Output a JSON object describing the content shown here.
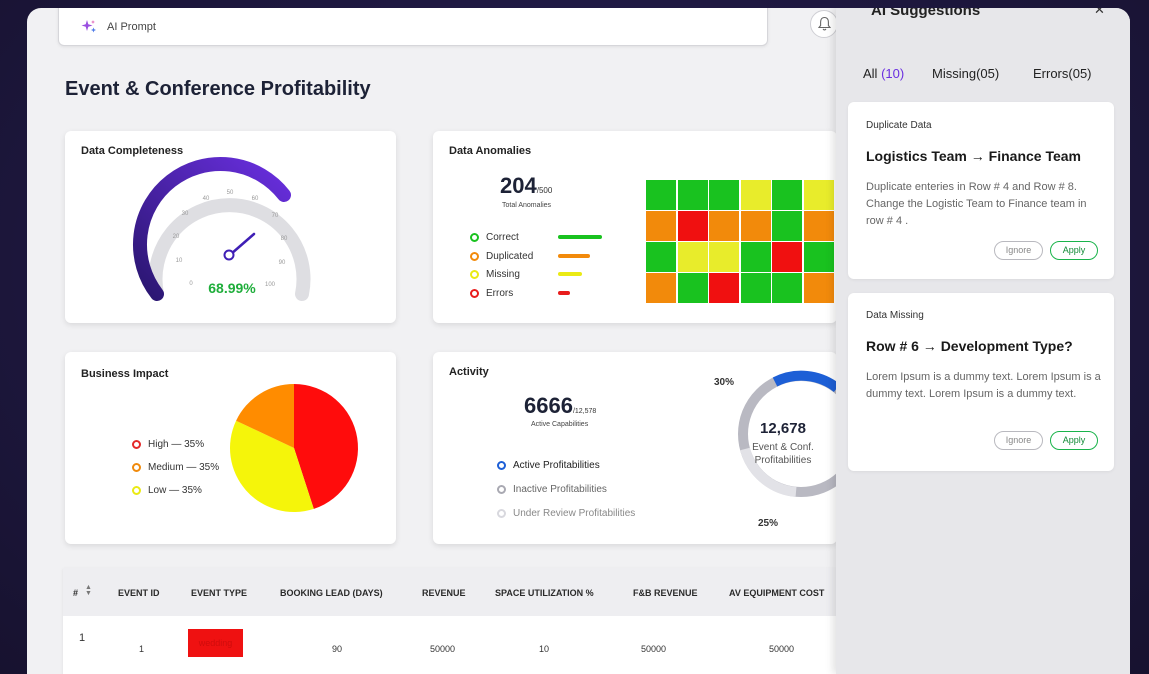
{
  "prompt": {
    "label": "AI Prompt"
  },
  "page_title": "Event & Conference Profitability",
  "completeness": {
    "title": "Data Completeness",
    "value_text": "68.99%",
    "value": 68.99,
    "ticks": [
      "0",
      "10",
      "20",
      "30",
      "40",
      "50",
      "60",
      "70",
      "80",
      "90",
      "100"
    ]
  },
  "anomalies": {
    "title": "Data Anomalies",
    "count": "204",
    "total": "/500",
    "caption": "Total Anomalies",
    "legend": [
      {
        "label": "Correct",
        "color": "#19c21f"
      },
      {
        "label": "Duplicated",
        "color": "#f28a0b"
      },
      {
        "label": "Missing",
        "color": "#eaea14"
      },
      {
        "label": "Errors",
        "color": "#e81c1c"
      }
    ],
    "grid_colors": [
      [
        "#19c21f",
        "#19c21f",
        "#19c21f",
        "#e8ec2b",
        "#19c21f",
        "#e8ec2b"
      ],
      [
        "#f28a0b",
        "#f01010",
        "#f28a0b",
        "#f28a0b",
        "#19c21f",
        "#f28a0b"
      ],
      [
        "#19c21f",
        "#e8ec2b",
        "#e8ec2b",
        "#19c21f",
        "#f01010",
        "#19c21f"
      ],
      [
        "#f28a0b",
        "#19c21f",
        "#f01010",
        "#19c21f",
        "#19c21f",
        "#f28a0b"
      ]
    ]
  },
  "impact": {
    "title": "Business Impact",
    "legend": [
      {
        "label": "High — 35%",
        "color": "#e42a2a"
      },
      {
        "label": "Medium — 35%",
        "color": "#f08a0c"
      },
      {
        "label": "Low — 35%",
        "color": "#eaea14"
      }
    ]
  },
  "chart_data": {
    "type": "pie",
    "slices": [
      {
        "label": "High",
        "value": 45,
        "color": "#ff0c0c"
      },
      {
        "label": "Low",
        "value": 37,
        "color": "#f5f50a"
      },
      {
        "label": "Medium",
        "value": 18,
        "color": "#ff8c00"
      }
    ]
  },
  "activity": {
    "title": "Activity",
    "count": "6666",
    "total": "/12,578",
    "caption": "Active Capabilities",
    "legend": [
      {
        "label": "Active Profitabilities",
        "color": "#1d5fd6"
      },
      {
        "label": "Inactive Profitabilities",
        "color": "#a9a9b2"
      },
      {
        "label": "Under Review Profitabilities",
        "color": "#d8d8de"
      }
    ],
    "donut_center_value": "12,678",
    "donut_center_line1": "Event & Conf.",
    "donut_center_line2": "Profitabilities",
    "label_top": "30%",
    "label_bottom": "25%"
  },
  "table": {
    "headers": [
      "#",
      "EVENT ID",
      "EVENT TYPE",
      "BOOKING LEAD (DAYS)",
      "REVENUE",
      "SPACE UTILIZATION %",
      "F&B REVENUE",
      "AV EQUIPMENT COST"
    ],
    "row": [
      "1",
      "1",
      "wedding",
      "90",
      "50000",
      "10",
      "50000",
      "50000"
    ]
  },
  "panel": {
    "title": "AI Suggestions",
    "tab_all": "All",
    "tab_all_count": "(10)",
    "tab_missing": "Missing(05)",
    "tab_errors": "Errors(05)",
    "cards": [
      {
        "kind": "Duplicate Data",
        "from": "Logistics Team",
        "to": "Finance Team",
        "body": "Duplicate enteries in Row # 4 and Row # 8. Change the Logistic Team to Finance team in row # 4 .",
        "ignore": "Ignore",
        "apply": "Apply"
      },
      {
        "kind": "Data Missing",
        "from": "Row # 6",
        "to": "Development Type?",
        "body": "Lorem Ipsum is a dummy text. Lorem Ipsum is a dummy text. Lorem Ipsum is a dummy text.",
        "ignore": "Ignore",
        "apply": "Apply"
      }
    ]
  }
}
